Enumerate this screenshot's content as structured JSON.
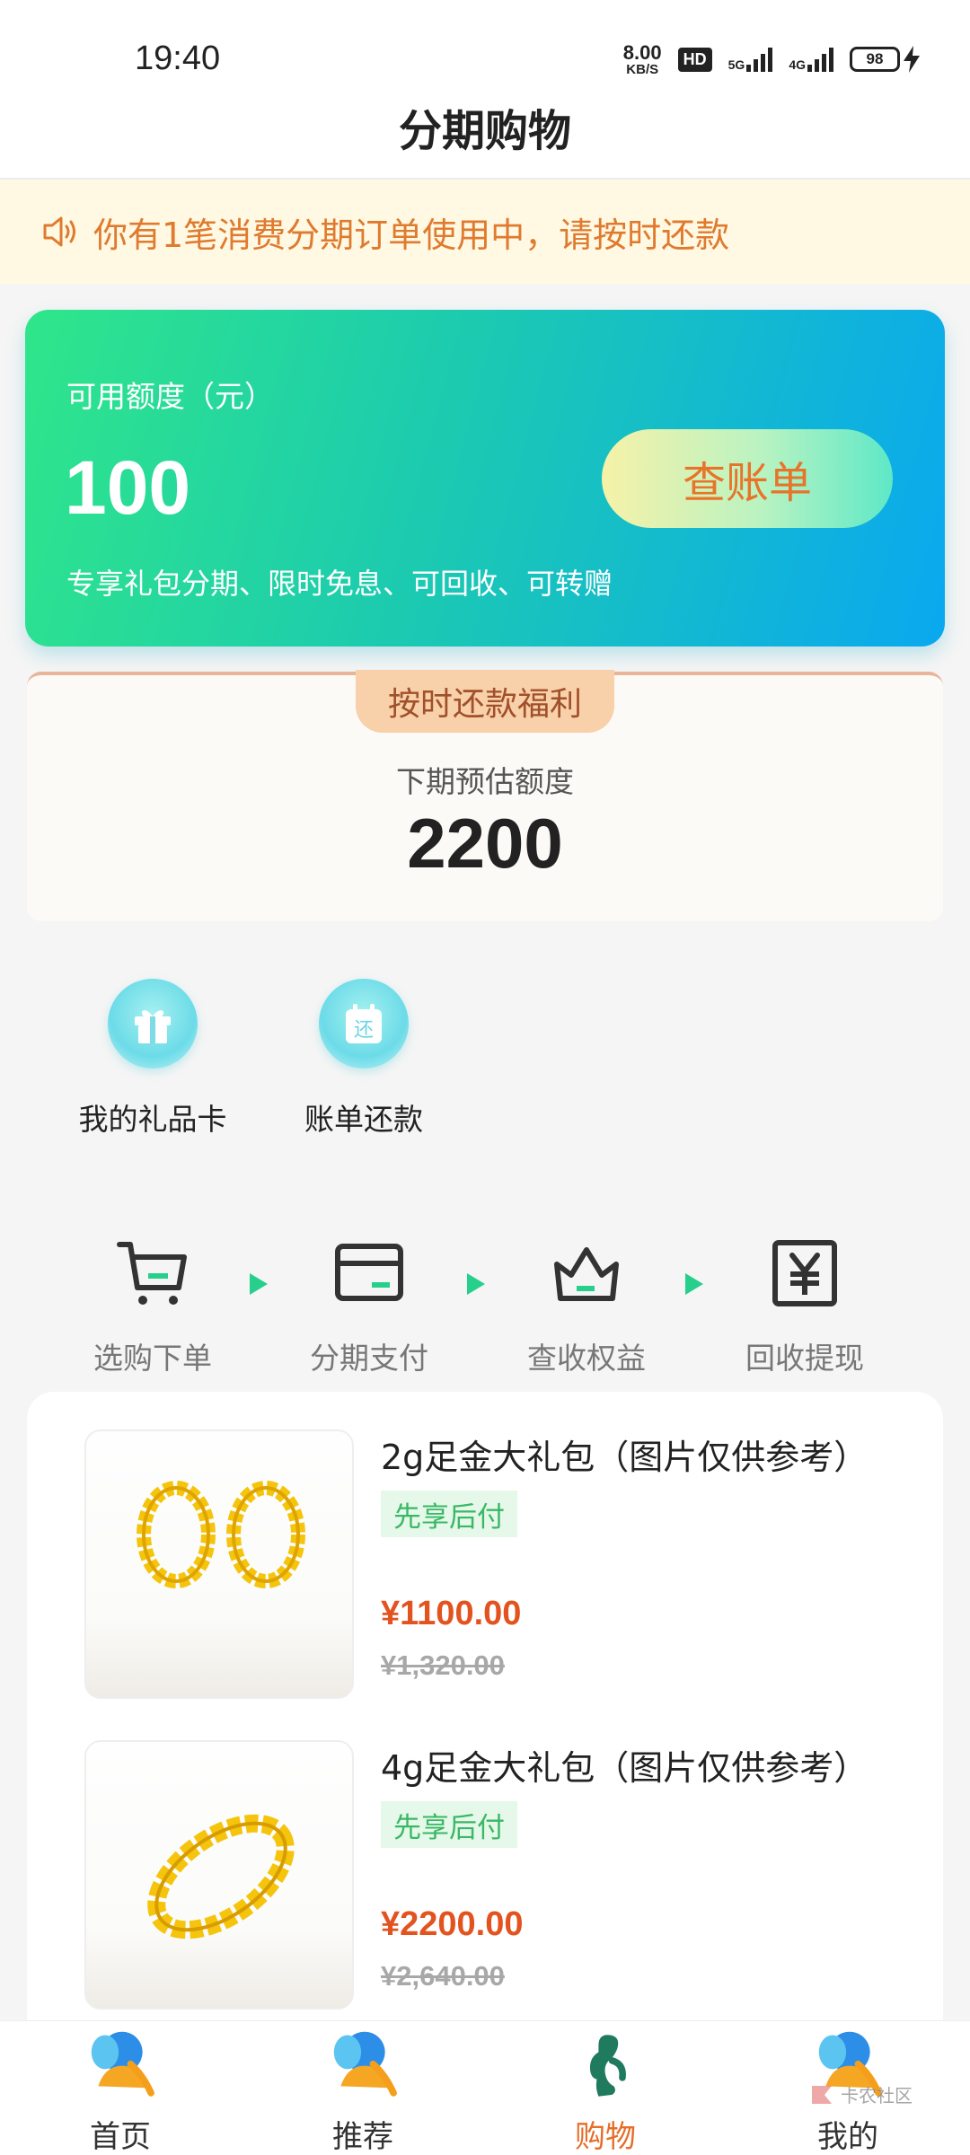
{
  "status_bar": {
    "time": "19:40",
    "net_speed_value": "8.00",
    "net_speed_unit": "KB/S",
    "hd_badge": "HD",
    "network_5g": "5G",
    "network_4g": "4G",
    "battery": "98"
  },
  "header": {
    "title": "分期购物"
  },
  "notice": {
    "text": "你有1笔消费分期订单使用中，请按时还款",
    "icon": "speaker-icon"
  },
  "credit": {
    "label": "可用额度（元）",
    "amount": "100",
    "description": "专享礼包分期、限时免息、可回收、可转赠",
    "bill_button": "查账单"
  },
  "benefit": {
    "tag": "按时还款福利",
    "label": "下期预估额度",
    "value": "2200"
  },
  "quick_actions": [
    {
      "label": "我的礼品卡",
      "icon": "gift-icon"
    },
    {
      "label": "账单还款",
      "icon": "calendar-repay-icon",
      "icon_text": "还"
    }
  ],
  "steps": [
    {
      "label": "选购下单",
      "icon": "cart-icon"
    },
    {
      "label": "分期支付",
      "icon": "card-icon"
    },
    {
      "label": "查收权益",
      "icon": "crown-icon"
    },
    {
      "label": "回收提现",
      "icon": "yen-icon"
    }
  ],
  "products": [
    {
      "name": "2g足金大礼包（图片仅供参考）",
      "tag": "先享后付",
      "price": "¥1100.00",
      "original_price": "¥1,320.00",
      "image": "gold-earrings-image"
    },
    {
      "name": "4g足金大礼包（图片仅供参考）",
      "tag": "先享后付",
      "price": "¥2200.00",
      "original_price": "¥2,640.00",
      "image": "gold-ring-image"
    }
  ],
  "tabbar": [
    {
      "label": "首页",
      "icon": "elephant-home-icon",
      "active": false
    },
    {
      "label": "推荐",
      "icon": "elephant-recommend-icon",
      "active": false
    },
    {
      "label": "购物",
      "icon": "elephant-shop-icon",
      "active": true
    },
    {
      "label": "我的",
      "icon": "elephant-profile-icon",
      "active": false
    }
  ],
  "watermark": {
    "text": "卡农社区"
  },
  "colors": {
    "accent_orange": "#e56e2a",
    "accent_green": "#27cf8d",
    "price_red": "#e2531f",
    "notice_bg": "#fff9e3"
  }
}
